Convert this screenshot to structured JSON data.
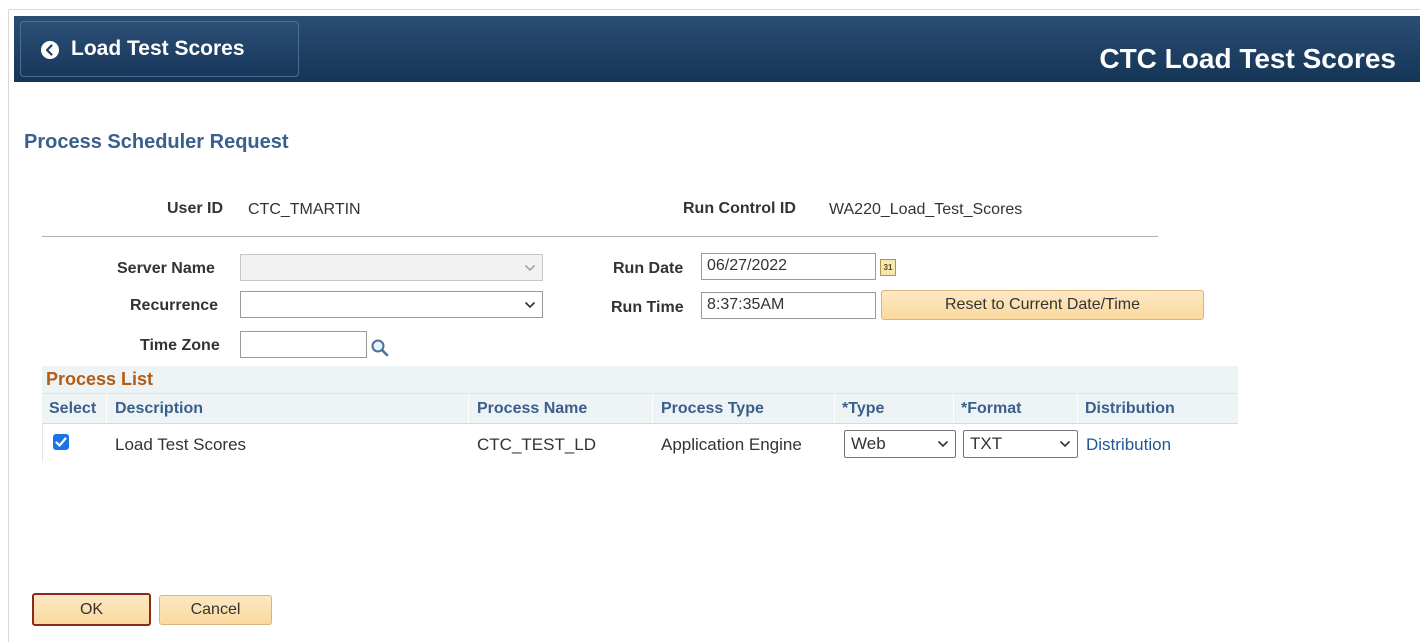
{
  "header": {
    "back_label": "Load Test Scores",
    "title": "CTC Load Test Scores"
  },
  "page": {
    "title": "Process Scheduler Request"
  },
  "ids": {
    "user_id_label": "User ID",
    "user_id_value": "CTC_TMARTIN",
    "run_control_label": "Run Control ID",
    "run_control_value": "WA220_Load_Test_Scores"
  },
  "form": {
    "server_name_label": "Server Name",
    "server_name_value": "",
    "recurrence_label": "Recurrence",
    "recurrence_value": "",
    "time_zone_label": "Time Zone",
    "time_zone_value": "",
    "run_date_label": "Run Date",
    "run_date_value": "06/27/2022",
    "run_time_label": "Run Time",
    "run_time_value": "8:37:35AM",
    "reset_button": "Reset to Current Date/Time",
    "calendar_icon_text": "31"
  },
  "process_list": {
    "title": "Process List",
    "columns": [
      "Select",
      "Description",
      "Process Name",
      "Process Type",
      "*Type",
      "*Format",
      "Distribution"
    ],
    "rows": [
      {
        "selected": true,
        "description": "Load Test Scores",
        "process_name": "CTC_TEST_LD",
        "process_type": "Application Engine",
        "type": "Web",
        "format": "TXT",
        "distribution": "Distribution"
      }
    ]
  },
  "footer": {
    "ok_label": "OK",
    "cancel_label": "Cancel"
  },
  "colors": {
    "header_bg": "#1d3f63",
    "page_title": "#3a5f8c",
    "section_title": "#b35c12",
    "button_bg": "#fbd99e",
    "link": "#1f5797",
    "checkbox": "#1a73e8"
  },
  "icons": [
    "chevron-left-icon",
    "calendar-icon",
    "search-icon",
    "chevron-down-icon",
    "checkmark-icon"
  ]
}
